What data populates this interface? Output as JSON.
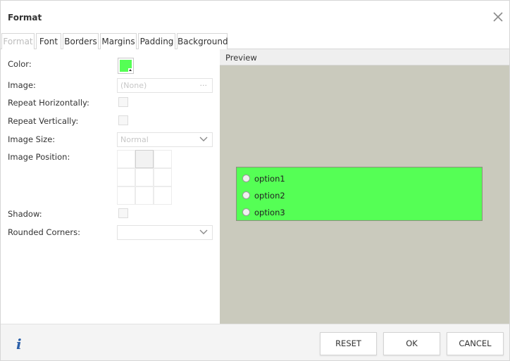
{
  "dialog": {
    "title": "Format"
  },
  "tabs": [
    {
      "label": "Format",
      "state": "disabled"
    },
    {
      "label": "Font",
      "state": "normal"
    },
    {
      "label": "Borders",
      "state": "normal"
    },
    {
      "label": "Margins",
      "state": "normal"
    },
    {
      "label": "Padding",
      "state": "normal"
    },
    {
      "label": "Background",
      "state": "active"
    }
  ],
  "background": {
    "color_label": "Color:",
    "color_value": "#55ff55",
    "image_label": "Image:",
    "image_value": "(None)",
    "image_browse": "···",
    "repeat_h_label": "Repeat Horizontally:",
    "repeat_h_checked": false,
    "repeat_v_label": "Repeat Vertically:",
    "repeat_v_checked": false,
    "image_size_label": "Image Size:",
    "image_size_value": "Normal",
    "image_position_label": "Image Position:",
    "image_position_selected": "top-center",
    "shadow_label": "Shadow:",
    "shadow_checked": false,
    "rounded_label": "Rounded Corners:",
    "rounded_value": ""
  },
  "preview": {
    "title": "Preview",
    "background_color": "#cacabd",
    "box_color": "#55ff55",
    "options": [
      "option1",
      "option2",
      "option3"
    ]
  },
  "footer": {
    "info_glyph": "i",
    "reset_label": "RESET",
    "ok_label": "OK",
    "cancel_label": "CANCEL"
  },
  "icons": {
    "close": "close-icon",
    "info": "info-icon",
    "dropdown": "chevron-down-icon"
  }
}
